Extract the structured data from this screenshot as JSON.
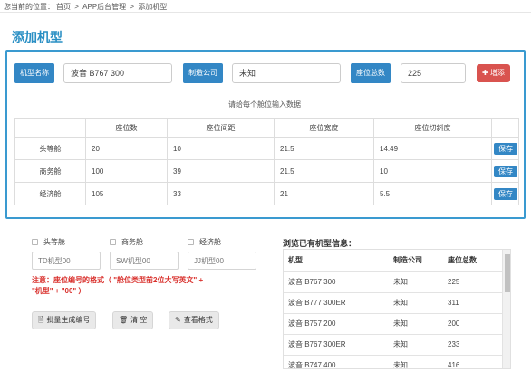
{
  "breadcrumb": {
    "prefix": "您当前的位置：",
    "items": [
      "首页",
      "APP后台管理",
      "添加机型"
    ],
    "separator": ">"
  },
  "page_title": "添加机型",
  "form": {
    "model_label": "机型名称",
    "model_value": "波音 B767 300",
    "maker_label": "制造公司",
    "maker_value": "未知",
    "seats_label": "座位总数",
    "seats_value": "225",
    "add_button": "增添"
  },
  "hint": "请给每个舱位输入数据",
  "seat_table": {
    "headers": [
      "",
      "座位数",
      "座位间距",
      "座位宽度",
      "座位切斜度",
      ""
    ],
    "rows": [
      {
        "cabin": "头等舱",
        "seats": "20",
        "pitch": "10",
        "width": "21.5",
        "recline": "14.49",
        "action": "保存"
      },
      {
        "cabin": "商务舱",
        "seats": "100",
        "pitch": "39",
        "width": "21.5",
        "recline": "10",
        "action": "保存"
      },
      {
        "cabin": "经济舱",
        "seats": "105",
        "pitch": "33",
        "width": "21",
        "recline": "5.5",
        "action": "保存"
      }
    ]
  },
  "cabin_select": {
    "options": [
      {
        "label": "头等舱",
        "placeholder": "TD机型00"
      },
      {
        "label": "商务舱",
        "placeholder": "SW机型00"
      },
      {
        "label": "经济舱",
        "placeholder": "JJ机型00"
      }
    ]
  },
  "notice": {
    "line1": "注意：座位编号的格式（ \"舱位类型前2位大写英文\" +",
    "line2": "\"机型\" + \"00\" ）"
  },
  "actions": {
    "batch_label": "批量生成编号",
    "clear_label": "清 空",
    "view_label": "查看格式"
  },
  "browse": {
    "title": "浏览已有机型信息：",
    "headers": [
      "机型",
      "制造公司",
      "座位总数"
    ],
    "rows": [
      [
        "波音 B767 300",
        "未知",
        "225"
      ],
      [
        "波音 B777 300ER",
        "未知",
        "311"
      ],
      [
        "波音 B757 200",
        "未知",
        "200"
      ],
      [
        "波音 B767 300ER",
        "未知",
        "233"
      ],
      [
        "波音 B747 400",
        "未知",
        "416"
      ]
    ]
  },
  "colors": {
    "accent": "#3387c5",
    "title": "#2a8fc4",
    "danger": "#d9534f",
    "warning_text": "#d9302c",
    "panel_border": "#3a9ad0"
  }
}
